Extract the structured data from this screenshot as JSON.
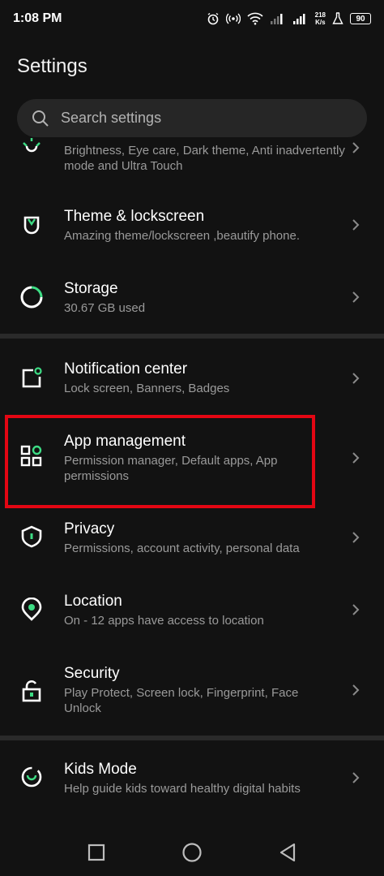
{
  "status_bar": {
    "time": "1:08 PM",
    "net_speed_value": "218",
    "net_speed_unit": "K/s",
    "battery": "90"
  },
  "page": {
    "title": "Settings"
  },
  "search": {
    "placeholder": "Search settings"
  },
  "colors": {
    "accent": "#3ddc84",
    "highlight": "#e30613",
    "background": "#121212"
  },
  "items": [
    {
      "title": "",
      "subtitle": "Brightness, Eye care, Dark theme, Anti inadvertently mode and Ultra Touch",
      "icon": "display-icon"
    },
    {
      "title": "Theme & lockscreen",
      "subtitle": "Amazing theme/lockscreen ,beautify phone.",
      "icon": "theme-icon"
    },
    {
      "title": "Storage",
      "subtitle": "30.67 GB used",
      "icon": "storage-icon"
    },
    {
      "title": "Notification center",
      "subtitle": "Lock screen, Banners, Badges",
      "icon": "notification-icon"
    },
    {
      "title": "App management",
      "subtitle": "Permission manager, Default apps, App permissions",
      "icon": "apps-icon"
    },
    {
      "title": "Privacy",
      "subtitle": "Permissions, account activity, personal data",
      "icon": "shield-icon"
    },
    {
      "title": "Location",
      "subtitle": "On - 12 apps have access to location",
      "icon": "location-icon"
    },
    {
      "title": "Security",
      "subtitle": "Play Protect, Screen lock, Fingerprint, Face Unlock",
      "icon": "lock-icon"
    },
    {
      "title": "Kids Mode",
      "subtitle": "Help guide kids toward healthy digital habits",
      "icon": "kids-icon"
    }
  ]
}
